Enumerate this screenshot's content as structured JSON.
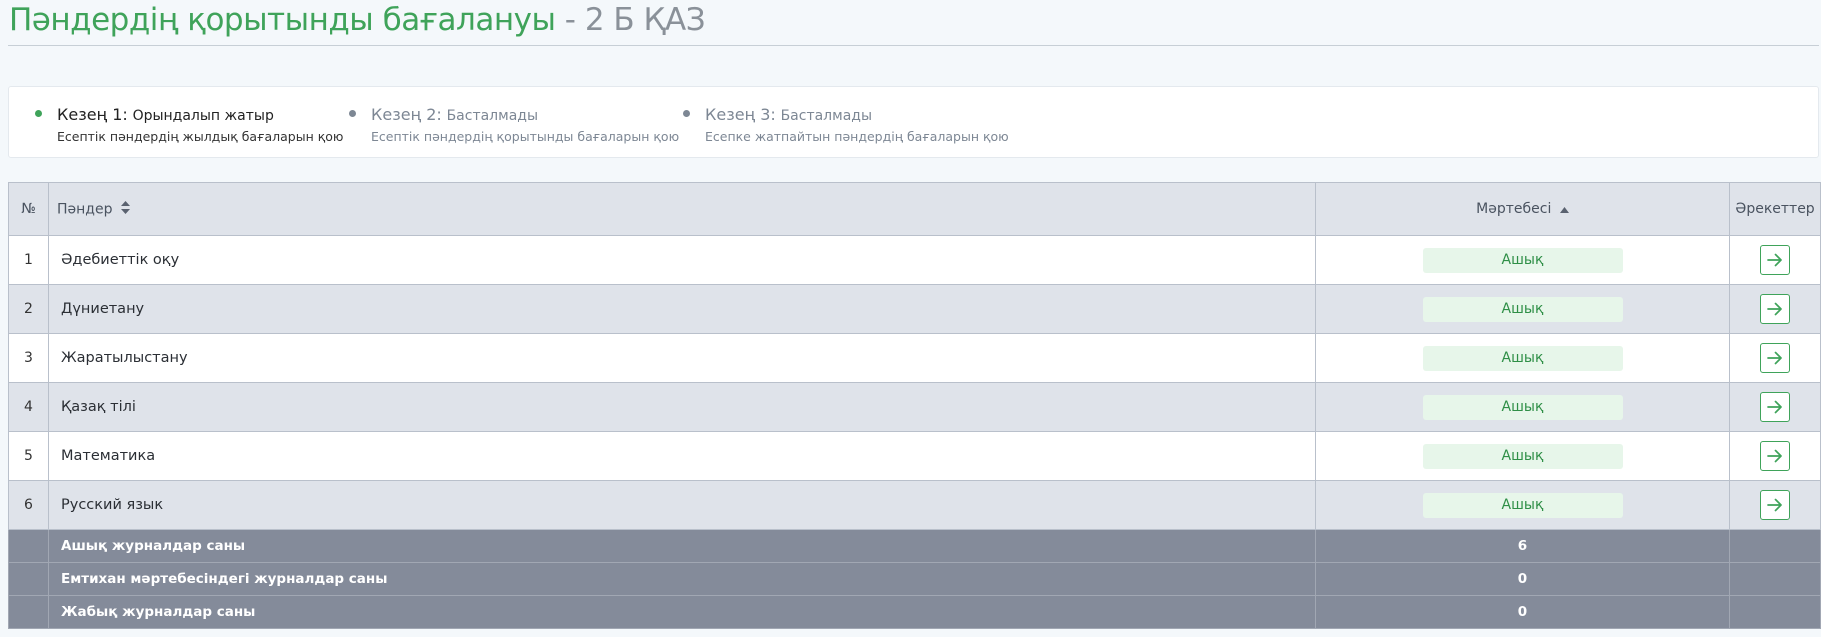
{
  "header": {
    "title_main": "Пәндердің қорытынды бағалануы",
    "title_sep": " - ",
    "title_class": "2 Б ҚАЗ"
  },
  "stages": [
    {
      "label": "Кезең 1:",
      "state": "Орындалып жатыр",
      "desc": "Есептік пәндердің жылдық бағаларын қою",
      "active": true
    },
    {
      "label": "Кезең 2:",
      "state": "Басталмады",
      "desc": "Есептік пәндердің қорытынды бағаларын қою",
      "active": false
    },
    {
      "label": "Кезең 3:",
      "state": "Басталмады",
      "desc": "Есепке жатпайтын пәндердің бағаларын қою",
      "active": false
    }
  ],
  "table": {
    "headers": {
      "num": "№",
      "subject": "Пәндер",
      "status": "Мәртебесі",
      "actions": "Әрекеттер"
    },
    "rows": [
      {
        "num": "1",
        "subject": "Әдебиеттік оқу",
        "status": "Ашық"
      },
      {
        "num": "2",
        "subject": "Дүниетану",
        "status": "Ашық"
      },
      {
        "num": "3",
        "subject": "Жаратылыстану",
        "status": "Ашық"
      },
      {
        "num": "4",
        "subject": "Қазақ тілі",
        "status": "Ашық"
      },
      {
        "num": "5",
        "subject": "Математика",
        "status": "Ашық"
      },
      {
        "num": "6",
        "subject": "Русский язык",
        "status": "Ашық"
      }
    ],
    "summary": [
      {
        "label": "Ашық журналдар саны",
        "value": "6"
      },
      {
        "label": "Емтихан мәртебесіндегі журналдар саны",
        "value": "0"
      },
      {
        "label": "Жабық журналдар саны",
        "value": "0"
      }
    ]
  },
  "colors": {
    "accent": "#3fa35a",
    "inactive_dot": "#7d8794",
    "badge_bg": "#e7f6ea",
    "summary_bg": "#848b9a"
  },
  "icons": {
    "action": "arrow-right-icon",
    "subject_sort": "sort-both-icon",
    "status_sort": "sort-asc-icon"
  }
}
